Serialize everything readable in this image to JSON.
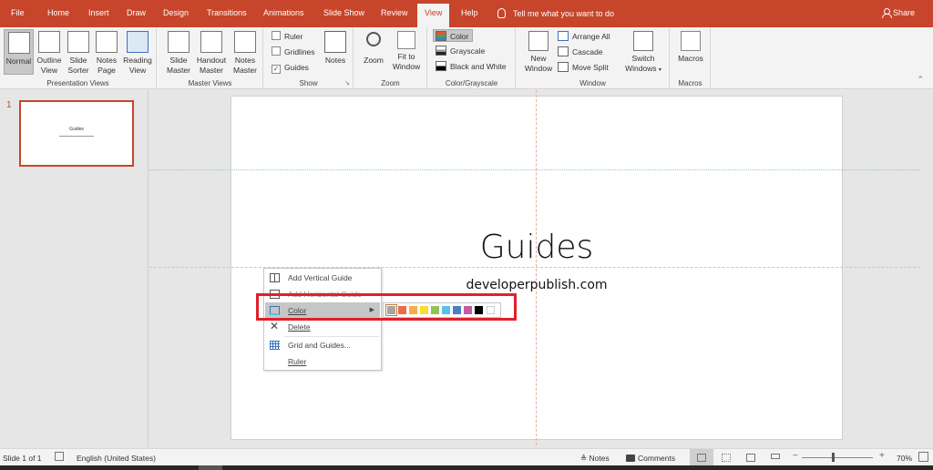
{
  "tabs": [
    {
      "label": "File"
    },
    {
      "label": "Home"
    },
    {
      "label": "Insert"
    },
    {
      "label": "Draw"
    },
    {
      "label": "Design"
    },
    {
      "label": "Transitions"
    },
    {
      "label": "Animations"
    },
    {
      "label": "Slide Show"
    },
    {
      "label": "Review"
    },
    {
      "label": "View",
      "active": true
    },
    {
      "label": "Help"
    }
  ],
  "tell_me": "Tell me what you want to do",
  "share": "Share",
  "ribbon": {
    "presentation_views": {
      "label": "Presentation Views",
      "buttons": [
        {
          "line1": "Normal",
          "line2": "",
          "selected": true
        },
        {
          "line1": "Outline",
          "line2": "View"
        },
        {
          "line1": "Slide",
          "line2": "Sorter"
        },
        {
          "line1": "Notes",
          "line2": "Page"
        },
        {
          "line1": "Reading",
          "line2": "View"
        }
      ]
    },
    "master_views": {
      "label": "Master Views",
      "buttons": [
        {
          "line1": "Slide",
          "line2": "Master"
        },
        {
          "line1": "Handout",
          "line2": "Master"
        },
        {
          "line1": "Notes",
          "line2": "Master"
        }
      ]
    },
    "show": {
      "label": "Show",
      "checkboxes": [
        {
          "label": "Ruler",
          "checked": false
        },
        {
          "label": "Gridlines",
          "checked": false
        },
        {
          "label": "Guides",
          "checked": true
        }
      ],
      "notes": "Notes"
    },
    "zoom": {
      "label": "Zoom",
      "zoom_btn": "Zoom",
      "fit_line1": "Fit to",
      "fit_line2": "Window"
    },
    "color_grayscale": {
      "label": "Color/Grayscale",
      "options": [
        {
          "label": "Color",
          "selected": true
        },
        {
          "label": "Grayscale"
        },
        {
          "label": "Black and White"
        }
      ]
    },
    "window": {
      "label": "Window",
      "new_line1": "New",
      "new_line2": "Window",
      "arrange_all": "Arrange All",
      "cascade": "Cascade",
      "move_split": "Move Split",
      "switch_line1": "Switch",
      "switch_line2": "Windows"
    },
    "macros": {
      "label": "Macros",
      "button": "Macros"
    }
  },
  "thumbnail": {
    "number": "1",
    "title": "Guides"
  },
  "slide": {
    "title": "Guides",
    "subtitle": "developerpublish.com"
  },
  "context_menu": {
    "items": [
      {
        "label": "Add Vertical Guide"
      },
      {
        "label": "Add Horizontal Guide"
      },
      {
        "label": "Color",
        "has_submenu": true
      },
      {
        "label": "Delete"
      },
      {
        "label": "Grid and Guides..."
      },
      {
        "label": "Ruler"
      }
    ]
  },
  "color_palette": {
    "colors": [
      "#a5a5a5",
      "#ec6b4d",
      "#f6ac47",
      "#fddc31",
      "#92c452",
      "#5bc0eb",
      "#4a7fc4",
      "#c55aa9",
      "#000000",
      "#ffffff"
    ],
    "selected_index": 0
  },
  "status": {
    "slide_info": "Slide 1 of 1",
    "language": "English (United States)",
    "notes": "Notes",
    "comments": "Comments",
    "zoom_percent": "70%",
    "zoom_value": 70
  }
}
